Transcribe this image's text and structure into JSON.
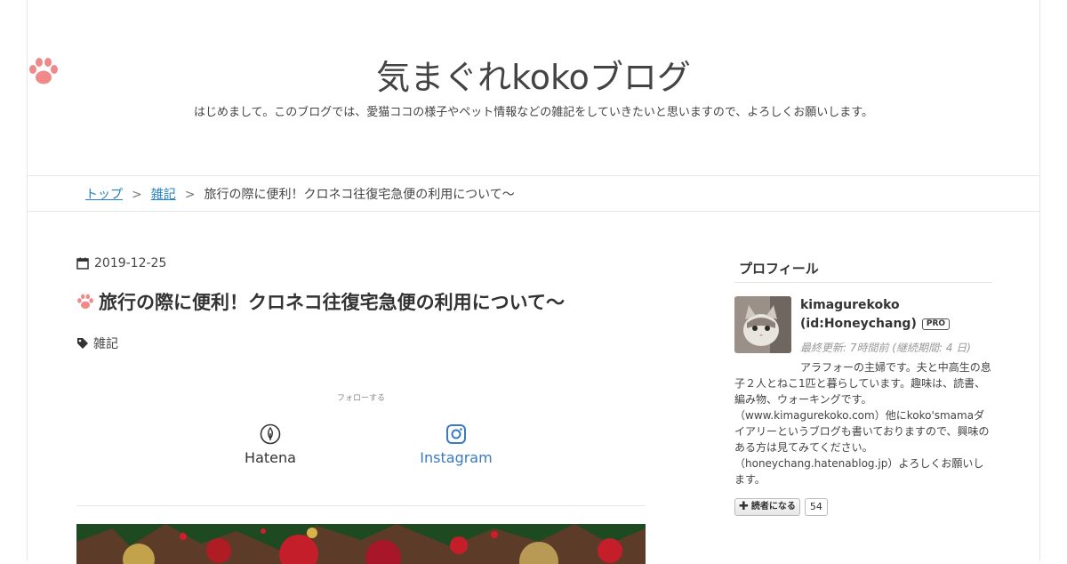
{
  "blog": {
    "title": "気まぐれkokoブログ",
    "description": "はじめまして。このブログでは、愛猫ココの様子やペット情報などの雑記をしていきたいと思いますので、よろしくお願いします。"
  },
  "breadcrumb": {
    "items": [
      "トップ",
      "雑記"
    ],
    "separator": ">",
    "current": "旅行の際に便利！クロネコ往復宅急便の利用について〜"
  },
  "entry": {
    "date": "2019-12-25",
    "title": "旅行の際に便利！クロネコ往復宅急便の利用について〜",
    "category": "雑記",
    "follow_label": "フォローする",
    "follow_buttons": [
      "Hatena",
      "Instagram"
    ]
  },
  "sidebar": {
    "profile_title": "プロフィール",
    "name_line1": "kimagurekoko",
    "name_line2": "(id:Honeychang)",
    "pro_badge": "PRO",
    "updated": "最終更新: 7時間前 (継続期間: 4 日)",
    "bio": "アラフォーの主婦です。夫と中高生の息子２人とねこ1匹と暮らしています。趣味は、読書、編み物、ウォーキングです。（www.kimagurekoko.com）他にkoko'smamaダイアリーというブログも書いておりますので、興味のある方は見てみてください。（honeychang.hatenablog.jp）よろしくお願いします。",
    "subscribe_label": "読者になる",
    "subscriber_count": "54"
  },
  "colors": {
    "accent_pink": "#f08a8a",
    "link_blue": "#2582c4",
    "instagram_blue": "#3a7ac0"
  },
  "icons": [
    "paw-icon",
    "calendar-icon",
    "tag-icon",
    "hatena-icon",
    "instagram-icon",
    "plus-icon"
  ]
}
